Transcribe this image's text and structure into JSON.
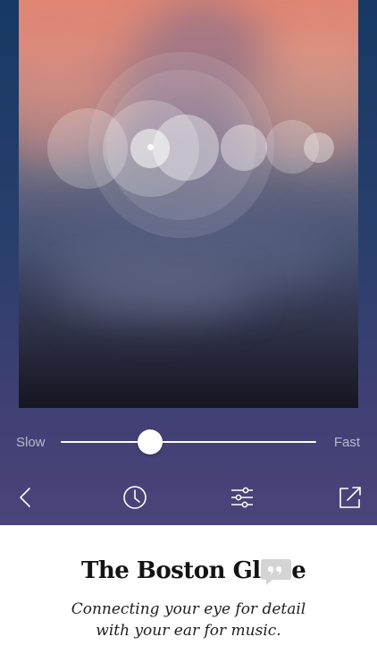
{
  "photo": {
    "description_icon": "bokeh-image"
  },
  "speed_slider": {
    "min_label": "Slow",
    "max_label": "Fast",
    "value": 0.35
  },
  "toolbar": {
    "back_icon": "chevron-left-icon",
    "history_icon": "clock-icon",
    "settings_icon": "sliders-icon",
    "share_icon": "share-icon"
  },
  "footer": {
    "brand": "The Boston Globe",
    "quote_icon": "quote-bubble-icon",
    "tagline_line1": "Connecting your eye for detail",
    "tagline_line2": "with your ear for music."
  },
  "colors": {
    "bar_top": "#173963",
    "bar_bottom": "#4a4479",
    "label": "#b9b8cf",
    "icon": "#ffffff"
  }
}
